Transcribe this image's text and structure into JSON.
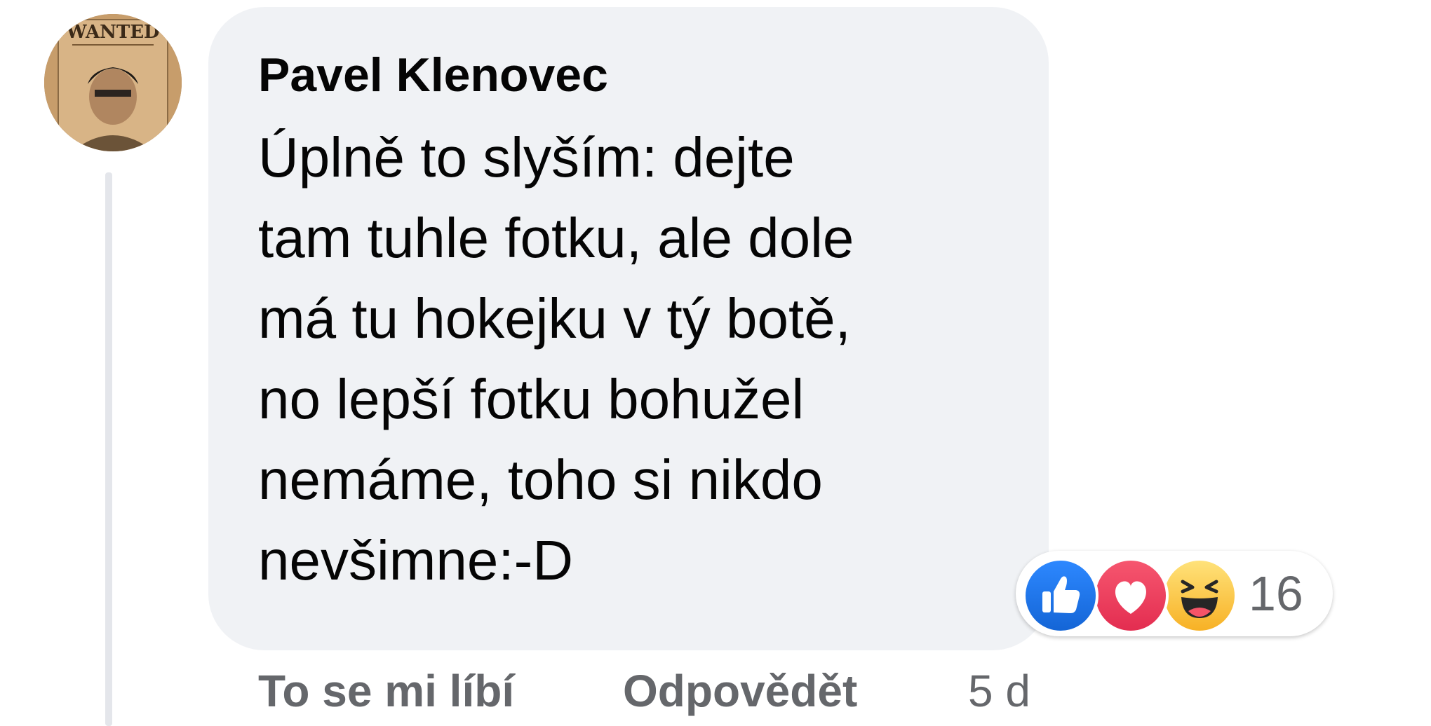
{
  "comment": {
    "author": "Pavel Klenovec",
    "avatar_icon": "wanted-poster-avatar",
    "avatar_text": "WANTED",
    "text_lines": [
      "Úplně to slyším: dejte",
      "tam tuhle fotku, ale dole",
      "má tu hokejku v tý botě,",
      "no lepší fotku bohužel",
      "nemáme, toho si nikdo",
      "nevšimne:-D"
    ],
    "bubble_color": "#f0f2f5",
    "reactions": {
      "icons": [
        "like-icon",
        "love-icon",
        "haha-icon"
      ],
      "count": "16"
    },
    "actions": {
      "like_label": "To se mi líbí",
      "reply_label": "Odpovědět",
      "timestamp": "5 d"
    }
  }
}
